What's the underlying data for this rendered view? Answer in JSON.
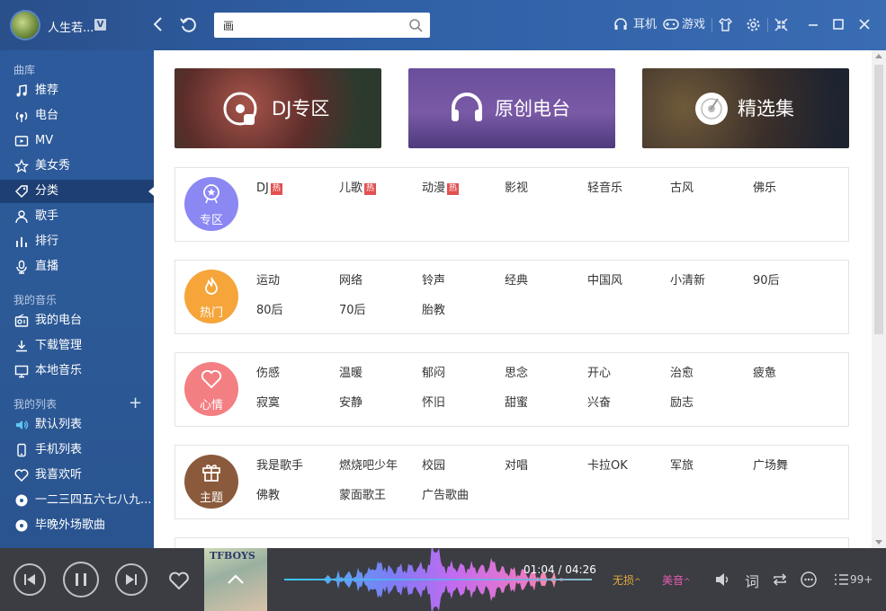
{
  "user": {
    "name": "人生若...",
    "vip_badge": "V"
  },
  "search": {
    "value": "画",
    "placeholder": ""
  },
  "top_right": {
    "headphones_label": "耳机",
    "game_label": "游戏"
  },
  "sidebar": {
    "library_title": "曲库",
    "library": [
      {
        "label": "推荐",
        "icon": "music-note-icon"
      },
      {
        "label": "电台",
        "icon": "radio-icon"
      },
      {
        "label": "MV",
        "icon": "mv-icon"
      },
      {
        "label": "美女秀",
        "icon": "star-icon"
      },
      {
        "label": "分类",
        "icon": "tag-icon",
        "active": true
      },
      {
        "label": "歌手",
        "icon": "singer-icon"
      },
      {
        "label": "排行",
        "icon": "chart-icon"
      },
      {
        "label": "直播",
        "icon": "mic-icon"
      }
    ],
    "my_music_title": "我的音乐",
    "my_music": [
      {
        "label": "我的电台",
        "icon": "radio-box-icon"
      },
      {
        "label": "下载管理",
        "icon": "download-icon"
      },
      {
        "label": "本地音乐",
        "icon": "monitor-icon"
      }
    ],
    "my_lists_title": "我的列表",
    "my_lists": [
      {
        "label": "默认列表",
        "icon": "speaker-icon"
      },
      {
        "label": "手机列表",
        "icon": "phone-icon"
      },
      {
        "label": "我喜欢听",
        "icon": "heart-icon"
      },
      {
        "label": "一二三四五六七八九...",
        "icon": "disc-icon"
      },
      {
        "label": "毕晚外场歌曲",
        "icon": "disc-icon"
      }
    ]
  },
  "banners": [
    {
      "label": "DJ专区",
      "icon": "dj-disc-icon"
    },
    {
      "label": "原创电台",
      "icon": "headphones-icon"
    },
    {
      "label": "精选集",
      "icon": "vinyl-icon"
    }
  ],
  "categories": [
    {
      "badge": "专区",
      "color": "#8b87f3",
      "icon": "badge-star-icon",
      "rows": [
        [
          {
            "t": "DJ",
            "hot": "热"
          },
          {
            "t": "儿歌",
            "hot": "热"
          },
          {
            "t": "动漫",
            "hot": "热"
          },
          {
            "t": "影视"
          },
          {
            "t": "轻音乐"
          },
          {
            "t": "古风"
          },
          {
            "t": "佛乐"
          }
        ]
      ]
    },
    {
      "badge": "热门",
      "color": "#f5a53a",
      "icon": "flame-icon",
      "rows": [
        [
          {
            "t": "运动"
          },
          {
            "t": "网络"
          },
          {
            "t": "铃声"
          },
          {
            "t": "经典"
          },
          {
            "t": "中国风"
          },
          {
            "t": "小清新"
          },
          {
            "t": "90后"
          }
        ],
        [
          {
            "t": "80后"
          },
          {
            "t": "70后"
          },
          {
            "t": "胎教"
          }
        ]
      ]
    },
    {
      "badge": "心情",
      "color": "#f37f82",
      "icon": "heart-outline-icon",
      "rows": [
        [
          {
            "t": "伤感"
          },
          {
            "t": "温暖"
          },
          {
            "t": "郁闷"
          },
          {
            "t": "思念"
          },
          {
            "t": "开心"
          },
          {
            "t": "治愈"
          },
          {
            "t": "疲惫"
          }
        ],
        [
          {
            "t": "寂寞"
          },
          {
            "t": "安静"
          },
          {
            "t": "怀旧"
          },
          {
            "t": "甜蜜"
          },
          {
            "t": "兴奋"
          },
          {
            "t": "励志"
          }
        ]
      ]
    },
    {
      "badge": "主题",
      "color": "#8b5a3c",
      "icon": "gift-icon",
      "rows": [
        [
          {
            "t": "我是歌手"
          },
          {
            "t": "燃烧吧少年"
          },
          {
            "t": "校园"
          },
          {
            "t": "对唱"
          },
          {
            "t": "卡拉OK"
          },
          {
            "t": "军旅"
          },
          {
            "t": "广场舞"
          }
        ],
        [
          {
            "t": "佛教"
          },
          {
            "t": "蒙面歌王"
          },
          {
            "t": "广告歌曲"
          }
        ]
      ]
    }
  ],
  "player": {
    "cover_text": "TFBOYS",
    "time": "01:04 / 04:26",
    "quality": "无损",
    "effect": "美音",
    "lyrics_label": "词",
    "playlist_count": "99+",
    "progress": 0.31
  },
  "colors": {
    "accent_hot": "#e25151",
    "quality": "#e6a93a",
    "effect": "#e85bb0"
  }
}
